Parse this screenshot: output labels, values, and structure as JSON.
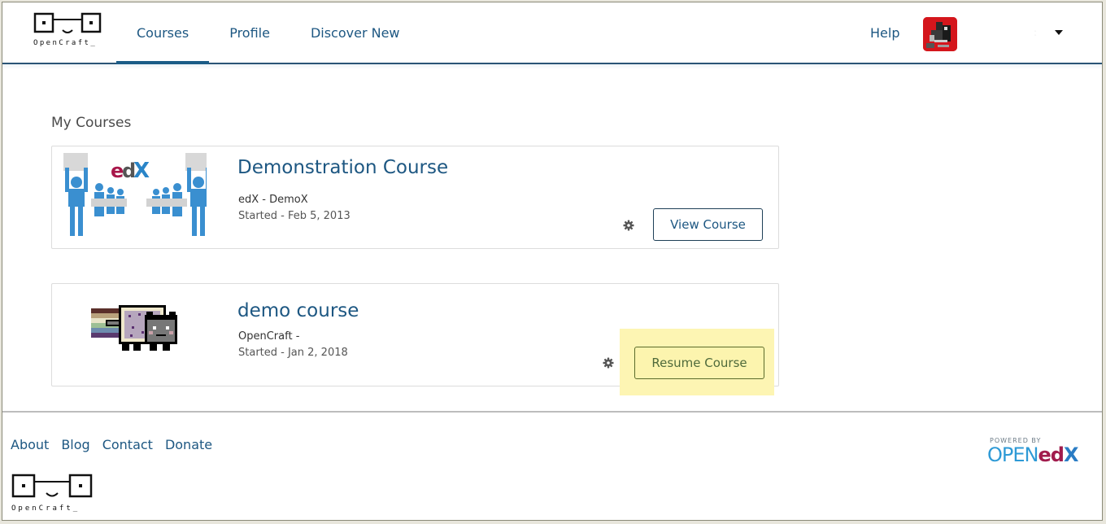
{
  "header": {
    "logo_text": "OpenCraft_",
    "nav": [
      {
        "label": "Courses",
        "active": true
      },
      {
        "label": "Profile",
        "active": false
      },
      {
        "label": "Discover New",
        "active": false
      }
    ],
    "help_label": "Help",
    "username": ":",
    "icons": {
      "avatar": "user-avatar",
      "dropdown": "caret-down-icon"
    }
  },
  "main": {
    "section_title": "My Courses",
    "courses": [
      {
        "title": "Demonstration Course",
        "org": "edX - DemoX",
        "date": "Started - Feb 5, 2013",
        "image": "edx-puzzle-people",
        "action_label": "View Course",
        "settings_icon": "gear-icon"
      },
      {
        "title": "demo course",
        "org": "OpenCraft -",
        "date": "Started - Jan 2, 2018",
        "image": "nyan-cat",
        "action_label": "Resume Course",
        "settings_icon": "gear-icon"
      }
    ]
  },
  "footer": {
    "links": [
      "About",
      "Blog",
      "Contact",
      "Donate"
    ],
    "logo_text": "OpenCraft_",
    "powered_by": "POWERED BY",
    "powered_open": "OPEN",
    "powered_ed": "ed",
    "powered_x": "X",
    "colors": {
      "link": "#1d5782",
      "highlight": "#fdf5b3"
    }
  }
}
